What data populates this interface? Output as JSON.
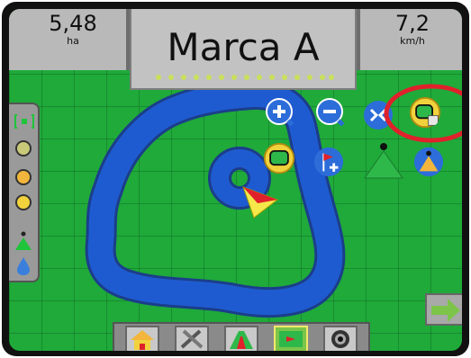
{
  "status": {
    "area_value": "5,48",
    "area_unit": "ha",
    "speed_value": "7,2",
    "speed_unit": "km/h"
  },
  "title": "Marca A",
  "map_controls": {
    "zoom_in": "zoom-in-icon",
    "zoom_out": "zoom-out-icon",
    "view_mode": "view-mode-icon",
    "delete_boundary": "delete-boundary-icon",
    "boundary": "boundary-icon",
    "add_marker": "add-marker-icon",
    "guidance_a": "guidance-point-a-icon",
    "guidance_b": "guidance-point-b-icon"
  },
  "colors": {
    "field": "#1faa3a",
    "swath": "#1f5bd0",
    "highlight": "#e0212b",
    "topbar": "#b9b9b9"
  },
  "navigation": [
    {
      "name": "home-icon"
    },
    {
      "name": "tools-icon"
    },
    {
      "name": "guidance-view-icon"
    },
    {
      "name": "map-view-icon"
    },
    {
      "name": "camera-icon"
    }
  ]
}
